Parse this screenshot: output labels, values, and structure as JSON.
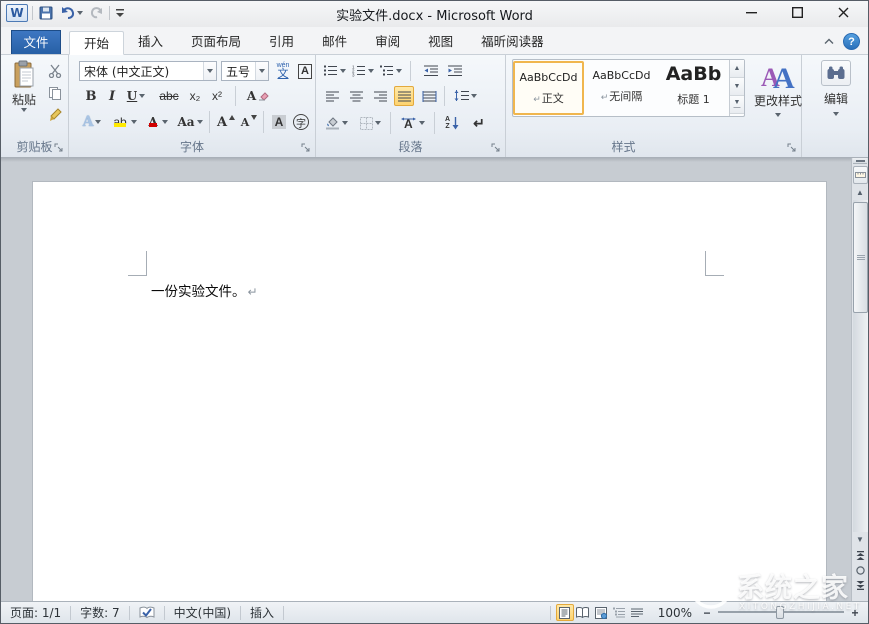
{
  "window": {
    "title": "实验文件.docx - Microsoft Word"
  },
  "icons": {
    "word_logo": "W",
    "help": "?"
  },
  "tabs": [
    {
      "label": "文件"
    },
    {
      "label": "开始"
    },
    {
      "label": "插入"
    },
    {
      "label": "页面布局"
    },
    {
      "label": "引用"
    },
    {
      "label": "邮件"
    },
    {
      "label": "审阅"
    },
    {
      "label": "视图"
    },
    {
      "label": "福昕阅读器"
    }
  ],
  "ribbon": {
    "clipboard": {
      "label": "剪贴板",
      "paste": "粘贴"
    },
    "font": {
      "label": "字体",
      "font_name": "宋体 (中文正文)",
      "font_size": "五号",
      "bold": "B",
      "italic": "I",
      "underline": "U",
      "strikethrough": "abc",
      "subscript": "x₂",
      "superscript": "x²",
      "clear_format": "A",
      "text_effects": "A",
      "highlight": "ab",
      "font_color": "A",
      "change_case": "Aa",
      "grow": "A",
      "shrink": "A",
      "shading": "A",
      "enclose": "字",
      "phonetic_top": "wén",
      "phonetic": "文",
      "char_border": "A"
    },
    "paragraph": {
      "label": "段落",
      "sort_a": "A",
      "sort_z": "Z",
      "show_hide": "↵"
    },
    "styles": {
      "label": "样式",
      "gallery": [
        {
          "preview": "AaBbCcDd",
          "mark": "↵",
          "name": "正文"
        },
        {
          "preview": "AaBbCcDd",
          "mark": "↵",
          "name": "无间隔"
        },
        {
          "preview": "AaBb",
          "mark": "",
          "name": "标题 1"
        }
      ],
      "change_styles": "更改样式"
    },
    "editing": {
      "label": "编辑"
    }
  },
  "document": {
    "text": "一份实验文件。",
    "paragraph_mark": "↵"
  },
  "statusbar": {
    "page": "页面: 1/1",
    "words": "字数: 7",
    "language": "中文(中国)",
    "insert_mode": "插入",
    "zoom_level": "100%",
    "zoom_out": "−",
    "zoom_in": "+"
  },
  "watermark": {
    "title": "系统之家",
    "subtitle": "XITONGZHIJIA.NET"
  }
}
